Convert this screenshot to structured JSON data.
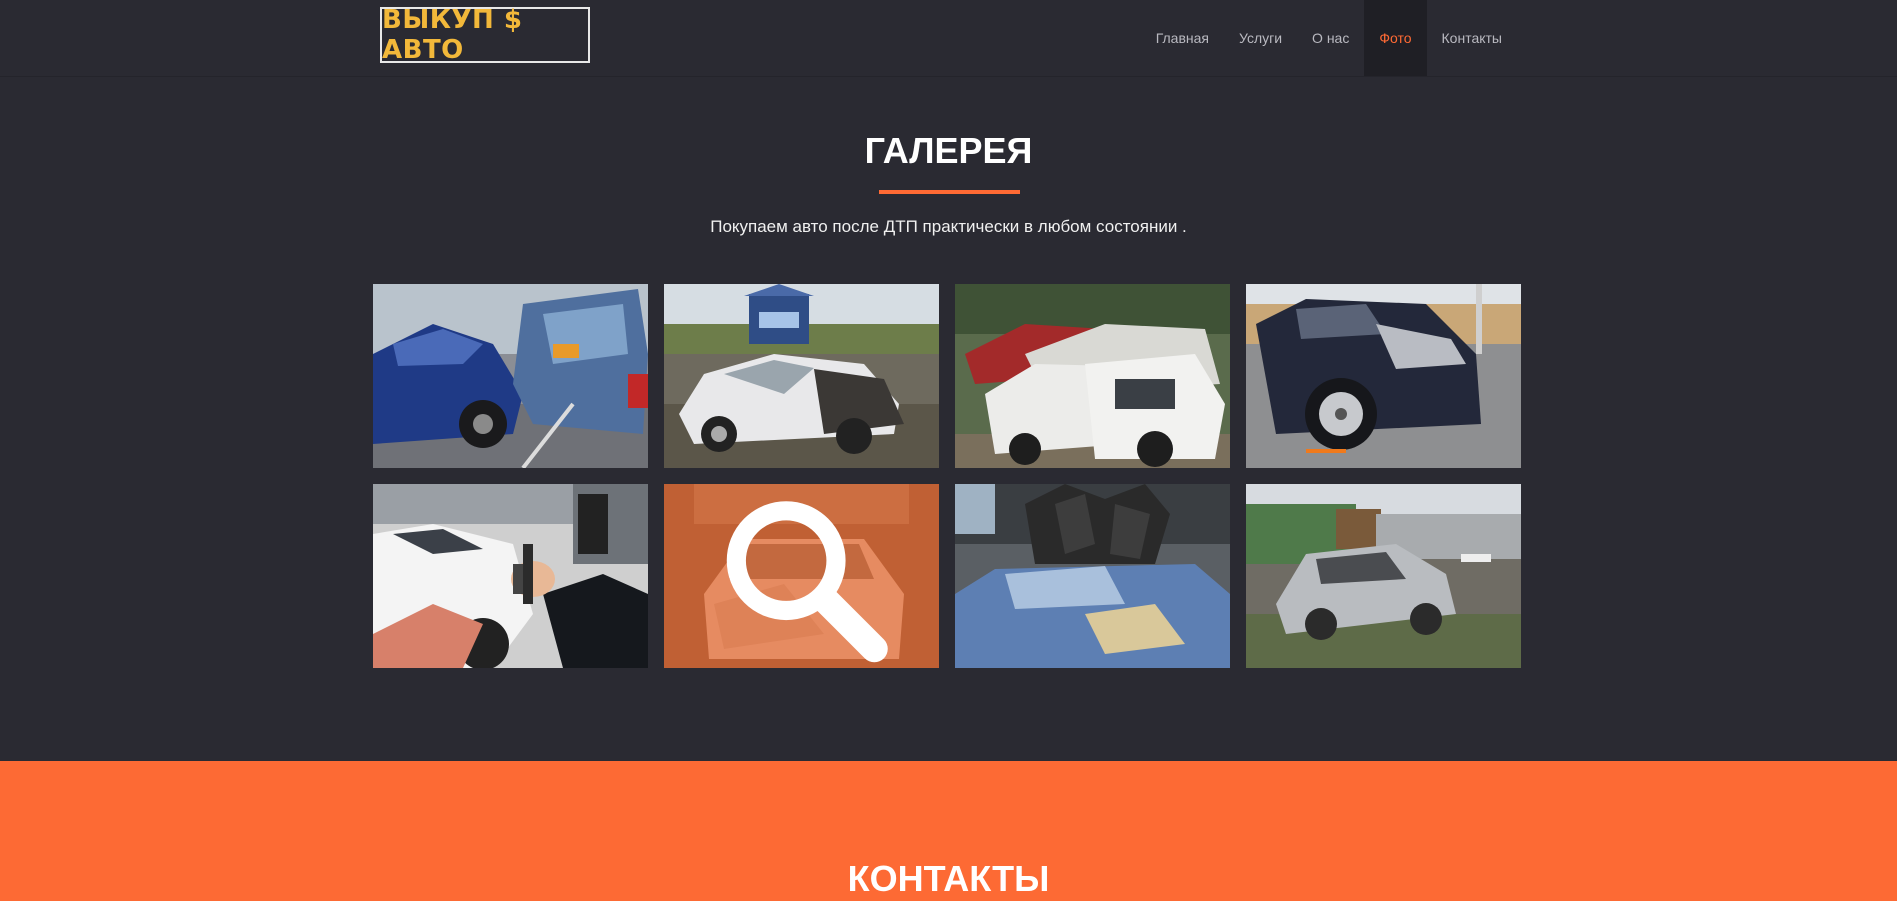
{
  "header": {
    "logo_text": "ВЫКУП $ АВТО",
    "nav": [
      {
        "label": "Главная",
        "active": false
      },
      {
        "label": "Услуги",
        "active": false
      },
      {
        "label": "О нас",
        "active": false
      },
      {
        "label": "Фото",
        "active": true
      },
      {
        "label": "Контакты",
        "active": false
      }
    ]
  },
  "gallery": {
    "title": "ГАЛЕРЕЯ",
    "subtitle": "Покупаем авто после ДТП практически в любом состоянии .",
    "photos": [
      {
        "icon": "crashed-blue-cars-photo"
      },
      {
        "icon": "wrecked-white-car-photo"
      },
      {
        "icon": "car-junkyard-photo"
      },
      {
        "icon": "damaged-dark-suv-photo"
      },
      {
        "icon": "keys-and-cash-photo"
      },
      {
        "icon": "crashed-car-in-garage-photo",
        "hovered": true
      },
      {
        "icon": "car-crusher-claw-photo"
      },
      {
        "icon": "burned-car-wreck-photo"
      }
    ],
    "hover_icon": "magnifier-icon"
  },
  "contacts": {
    "title": "КОНТАКТЫ"
  },
  "colors": {
    "background": "#2a2a32",
    "accent": "#ff6a34",
    "logo": "#f2b83a",
    "nav_text": "#b9b9c0"
  }
}
